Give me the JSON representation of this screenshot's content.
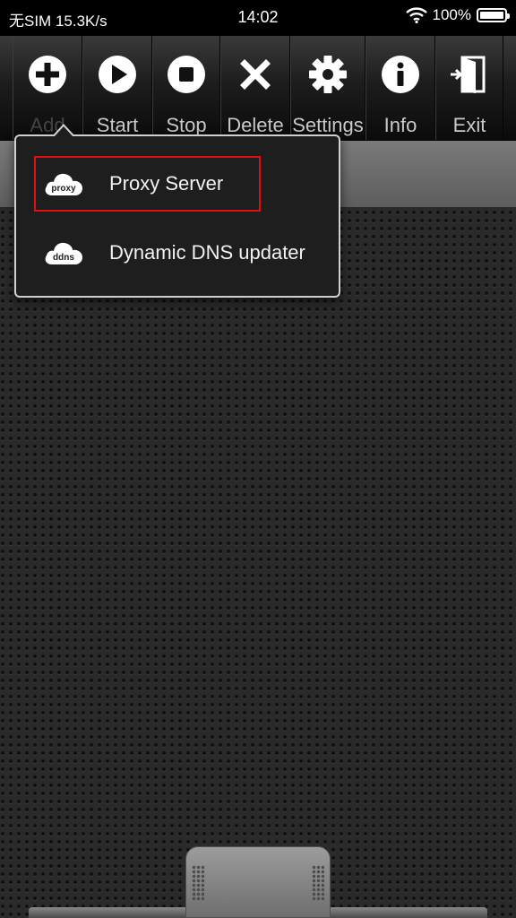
{
  "status_bar": {
    "carrier": "无SIM",
    "speed": "15.3K/s",
    "time": "14:02",
    "battery": "100%"
  },
  "toolbar": {
    "items": [
      {
        "label": "Add",
        "icon": "plus-circle-icon"
      },
      {
        "label": "Start",
        "icon": "play-icon"
      },
      {
        "label": "Stop",
        "icon": "stop-icon"
      },
      {
        "label": "Delete",
        "icon": "x-icon"
      },
      {
        "label": "Settings",
        "icon": "gear-icon"
      },
      {
        "label": "Info",
        "icon": "info-icon"
      },
      {
        "label": "Exit",
        "icon": "exit-door-icon"
      }
    ]
  },
  "popup_menu": {
    "items": [
      {
        "label": "Proxy Server",
        "icon_text": "proxy",
        "icon": "cloud-proxy-icon",
        "highlighted": true
      },
      {
        "label": "Dynamic DNS updater",
        "icon_text": "ddns",
        "icon": "cloud-ddns-icon",
        "highlighted": false
      }
    ],
    "highlight_color": "#e01010"
  }
}
